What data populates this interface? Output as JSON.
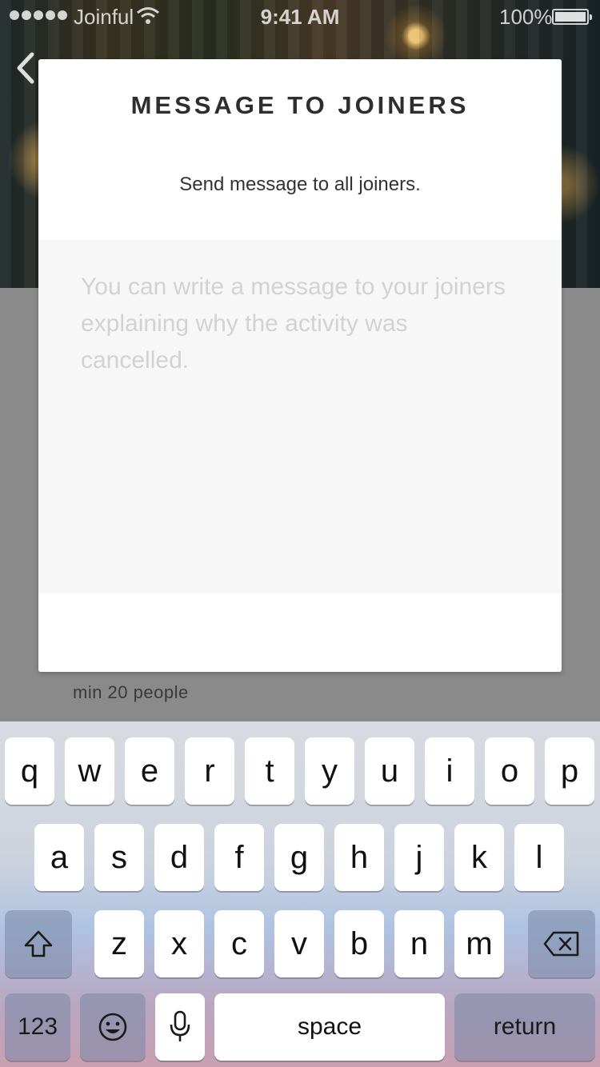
{
  "status_bar": {
    "carrier": "Joinful",
    "time": "9:41 AM",
    "battery": "100%"
  },
  "background": {
    "min_people_text": "min 20 people"
  },
  "modal": {
    "title": "MESSAGE TO JOINERS",
    "subtitle": "Send message to all joiners.",
    "message_value": "",
    "message_placeholder": "You can write a message to your joiners explaining why the activity was cancelled."
  },
  "keyboard": {
    "row1": [
      "q",
      "w",
      "e",
      "r",
      "t",
      "y",
      "u",
      "i",
      "o",
      "p"
    ],
    "row2": [
      "a",
      "s",
      "d",
      "f",
      "g",
      "h",
      "j",
      "k",
      "l"
    ],
    "row3": [
      "z",
      "x",
      "c",
      "v",
      "b",
      "n",
      "m"
    ],
    "numbers_label": "123",
    "space_label": "space",
    "return_label": "return"
  },
  "icons": {
    "back": "chevron-left-icon",
    "shift": "shift-icon",
    "delete": "backspace-icon",
    "emoji": "emoji-icon",
    "dictation": "microphone-icon"
  },
  "colors": {
    "caret": "#1a82fb",
    "placeholder": "#d2d2d2",
    "modal_bg": "#ffffff",
    "message_area_bg": "#f7f7f7"
  }
}
